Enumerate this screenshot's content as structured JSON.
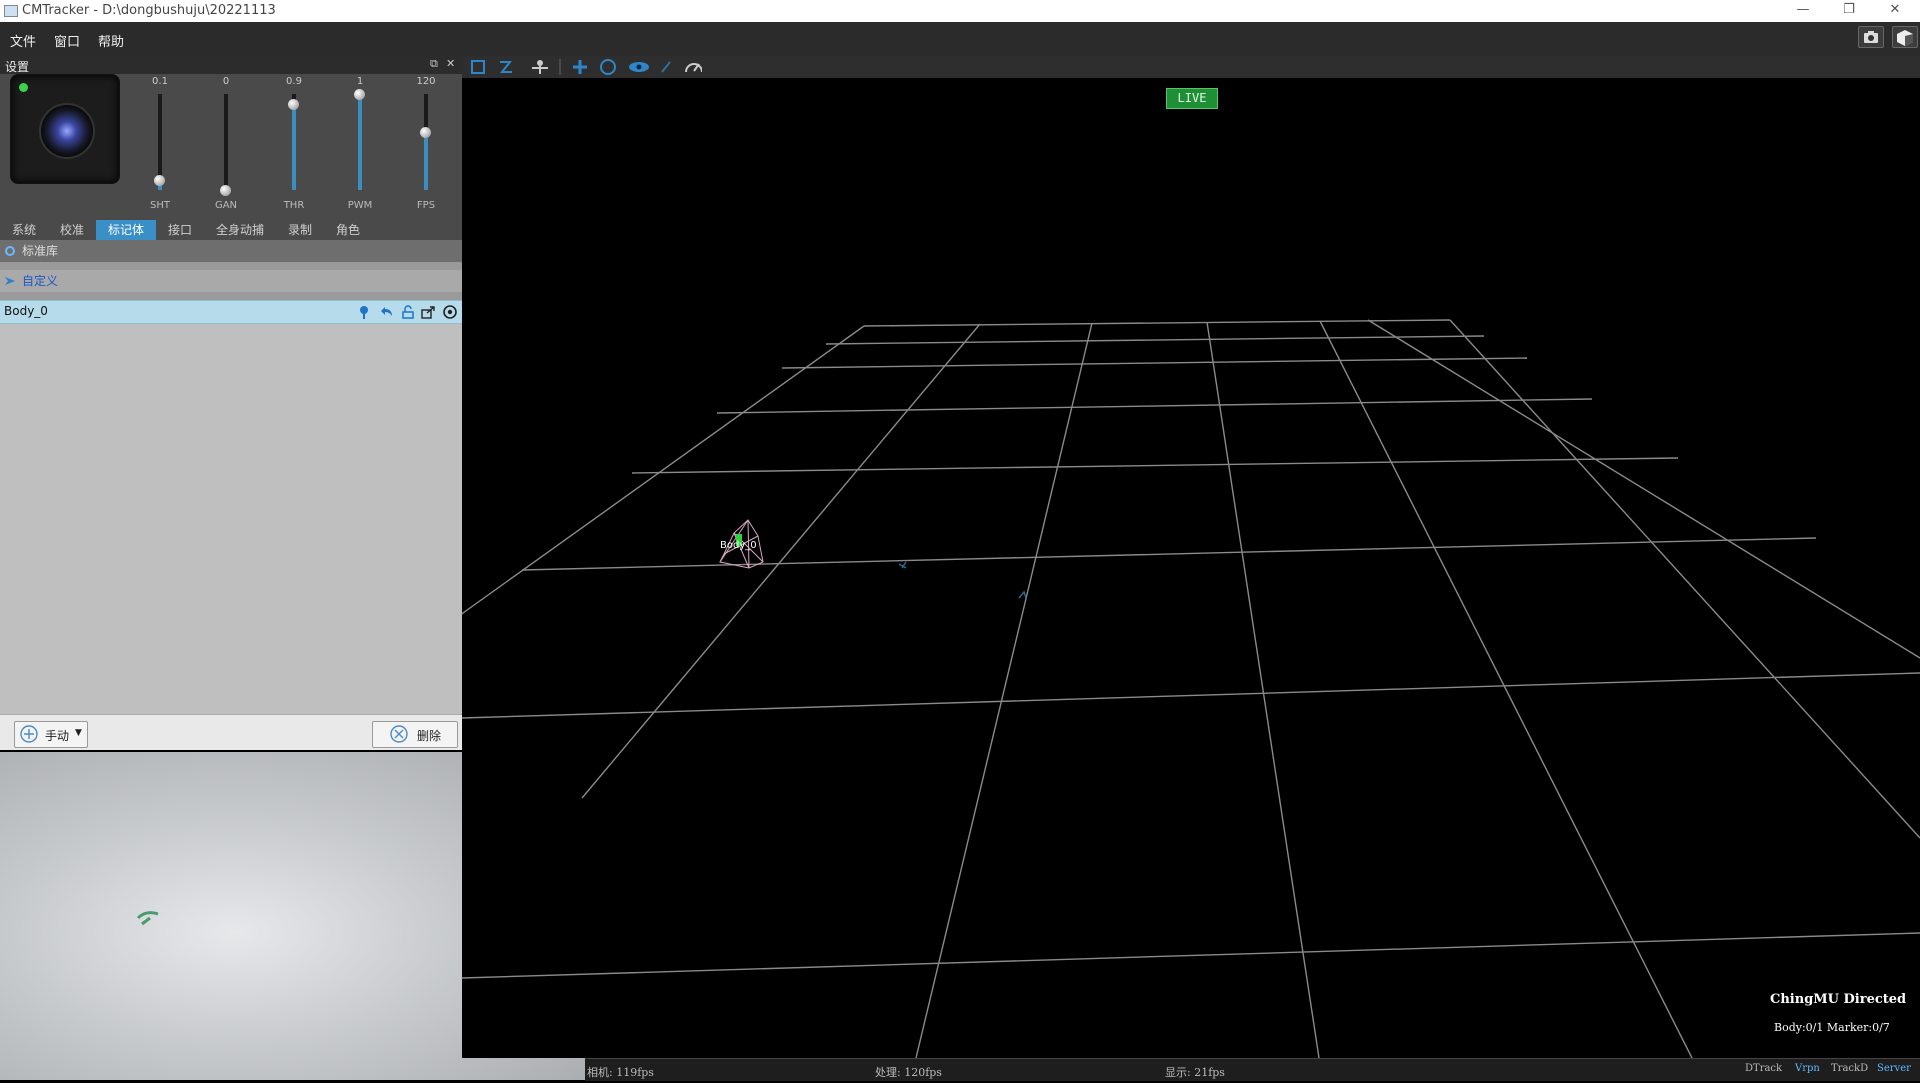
{
  "window": {
    "title": "CMTracker - D:\\dongbushuju\\20221113",
    "controls": [
      "—",
      "❐",
      "✕"
    ]
  },
  "menu": [
    "文件",
    "窗口",
    "帮助"
  ],
  "panel": {
    "title": "设置",
    "sliders": [
      {
        "value": "0.1",
        "label": "SHT",
        "level": 0.1
      },
      {
        "value": "0",
        "label": "GAN",
        "level": 0.0
      },
      {
        "value": "0.9",
        "label": "THR",
        "level": 0.9
      },
      {
        "value": "1",
        "label": "PWM",
        "level": 1.0
      },
      {
        "value": "120",
        "label": "FPS",
        "level": 0.6
      }
    ],
    "tabs": [
      "系统",
      "校准",
      "标记体",
      "接口",
      "全身动捕",
      "录制",
      "角色"
    ],
    "active_tab": "标记体",
    "section_library": "标准库",
    "section_custom": "自定义",
    "body_item": "Body_0",
    "add_button": "手动",
    "delete_button": "删除"
  },
  "viewport": {
    "live": "LIVE",
    "body_label": "Body_0",
    "brand": "ChingMU Directed",
    "counts": "Body:0/1  Marker:0/7"
  },
  "status": {
    "camera_fps": "相机: 119fps",
    "process_fps": "处理: 120fps",
    "display_fps": "显示: 21fps",
    "chips": [
      "DTrack",
      "Vrpn",
      "TrackD",
      "Server"
    ],
    "active_chips": [
      "Vrpn",
      "Server"
    ]
  },
  "colors": {
    "accent": "#3a8fc6",
    "live_green": "#1e8f35",
    "selected_row": "#b6dcec"
  }
}
